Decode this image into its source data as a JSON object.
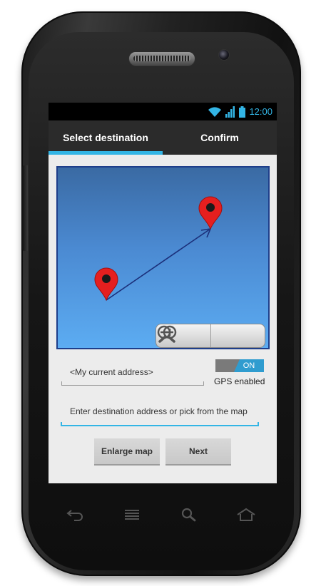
{
  "status_bar": {
    "time": "12:00",
    "icons": [
      "wifi-icon",
      "signal-icon",
      "battery-icon"
    ]
  },
  "tabs": [
    {
      "label": "Select destination",
      "active": true
    },
    {
      "label": "Confirm",
      "active": false
    }
  ],
  "map": {
    "markers": [
      "origin-marker",
      "destination-marker"
    ],
    "zoom_controls": [
      "zoom-out-icon",
      "zoom-in-icon"
    ]
  },
  "current_address": {
    "value": "<My current address>"
  },
  "gps": {
    "toggle_label": "ON",
    "label": "GPS enabled"
  },
  "destination": {
    "placeholder": "Enter destination address or pick from the map"
  },
  "buttons": {
    "enlarge_map": "Enlarge map",
    "next": "Next"
  },
  "hardware_keys": [
    "back-icon",
    "menu-icon",
    "search-icon",
    "home-icon"
  ],
  "colors": {
    "accent": "#33b5e5",
    "tab_bar": "#2b2b2b",
    "marker": "#e02020",
    "route_line": "#1b2f7a"
  }
}
